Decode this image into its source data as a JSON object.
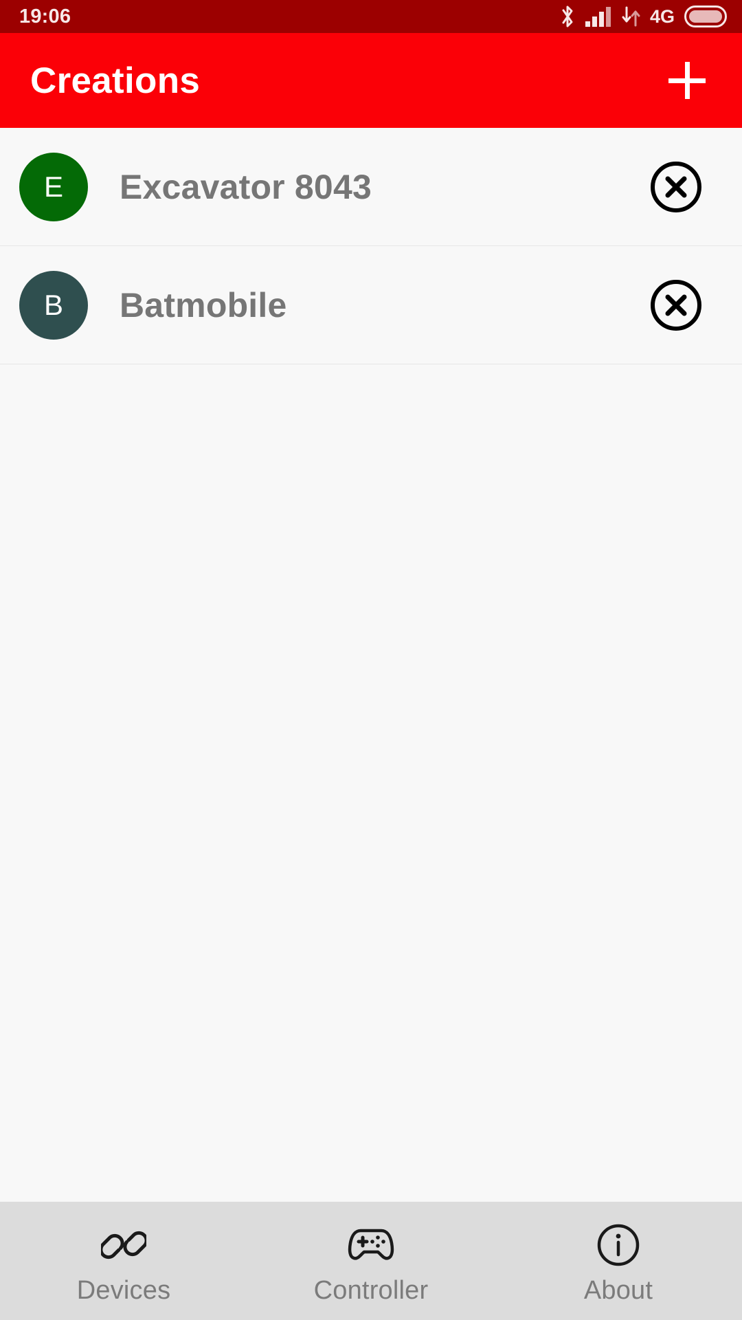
{
  "statusbar": {
    "time": "19:06",
    "network_label": "4G",
    "icons": [
      "bluetooth-icon",
      "signal-bars-icon",
      "data-transfer-icon",
      "battery-icon"
    ],
    "background_color": "#9c0000",
    "foreground_color": "#f7e8e8"
  },
  "appbar": {
    "title": "Creations",
    "add_label": "+",
    "background_color": "#fb0007",
    "title_color": "#ffffff"
  },
  "list": {
    "background_color": "#f8f8f8",
    "divider_color": "#e6e6e6",
    "title_color": "#767676",
    "items": [
      {
        "name": "Excavator 8043",
        "initial": "E",
        "avatar_color": "#046a06",
        "remove_icon": "close-circle-icon"
      },
      {
        "name": "Batmobile",
        "initial": "B",
        "avatar_color": "#2f4f4f",
        "remove_icon": "close-circle-icon"
      }
    ]
  },
  "bottomnav": {
    "background_color": "#dcdcdc",
    "label_color": "#7b7b7b",
    "items": [
      {
        "label": "Devices",
        "icon": "link-chain-icon"
      },
      {
        "label": "Controller",
        "icon": "gamepad-icon"
      },
      {
        "label": "About",
        "icon": "info-circle-icon"
      }
    ]
  }
}
